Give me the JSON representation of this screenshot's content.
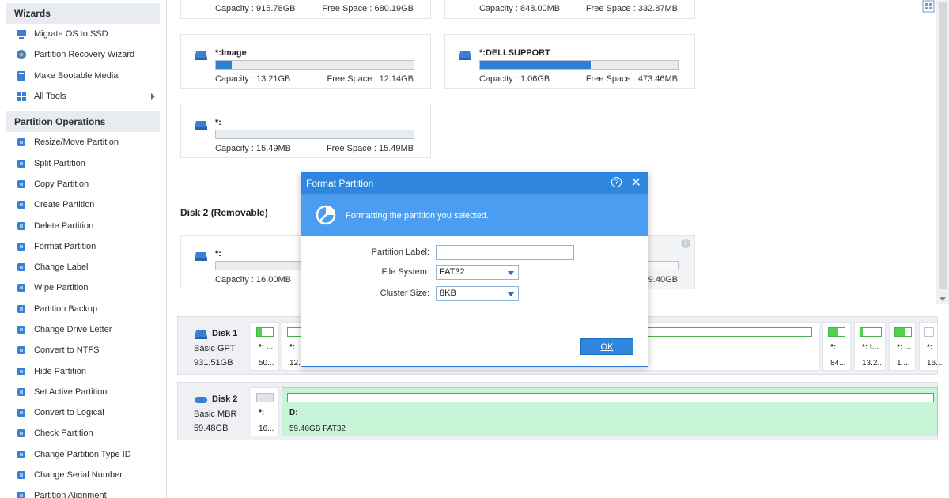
{
  "sidebar": {
    "wizards": {
      "title": "Wizards",
      "items": [
        {
          "label": "Migrate OS to SSD",
          "icon": "migrate-os-icon"
        },
        {
          "label": "Partition Recovery Wizard",
          "icon": "partition-recovery-icon"
        },
        {
          "label": "Make Bootable Media",
          "icon": "bootable-media-icon"
        },
        {
          "label": "All Tools",
          "icon": "all-tools-icon"
        }
      ]
    },
    "operations": {
      "title": "Partition Operations",
      "items": [
        {
          "label": "Resize/Move Partition",
          "icon": "resize-icon"
        },
        {
          "label": "Split Partition",
          "icon": "split-icon"
        },
        {
          "label": "Copy Partition",
          "icon": "copy-icon"
        },
        {
          "label": "Create Partition",
          "icon": "create-icon"
        },
        {
          "label": "Delete Partition",
          "icon": "delete-icon"
        },
        {
          "label": "Format Partition",
          "icon": "format-icon"
        },
        {
          "label": "Change Label",
          "icon": "label-icon"
        },
        {
          "label": "Wipe Partition",
          "icon": "wipe-icon"
        },
        {
          "label": "Partition Backup",
          "icon": "backup-icon"
        },
        {
          "label": "Change Drive Letter",
          "icon": "drive-letter-icon"
        },
        {
          "label": "Convert to NTFS",
          "icon": "convert-ntfs-icon"
        },
        {
          "label": "Hide Partition",
          "icon": "hide-icon"
        },
        {
          "label": "Set Active Partition",
          "icon": "set-active-icon"
        },
        {
          "label": "Convert to Logical",
          "icon": "convert-logical-icon"
        },
        {
          "label": "Check Partition",
          "icon": "check-icon"
        },
        {
          "label": "Change Partition Type ID",
          "icon": "type-id-icon"
        },
        {
          "label": "Change Serial Number",
          "icon": "serial-icon"
        },
        {
          "label": "Partition Alignment",
          "icon": "alignment-icon"
        }
      ]
    }
  },
  "partitions": {
    "top_left": {
      "capacity": "Capacity : 915.78GB",
      "free": "Free Space : 680.19GB"
    },
    "top_right": {
      "capacity": "Capacity : 848.00MB",
      "free": "Free Space : 332.87MB"
    },
    "image": {
      "name": "*:Image",
      "capacity": "Capacity : 13.21GB",
      "free": "Free Space : 12.14GB",
      "used_fraction": 0.08
    },
    "dellsupport": {
      "name": "*:DELLSUPPORT",
      "capacity": "Capacity : 1.06GB",
      "free": "Free Space : 473.46MB",
      "used_fraction": 0.56
    },
    "star": {
      "name": "*:",
      "capacity": "Capacity : 15.49MB",
      "free": "Free Space : 15.49MB",
      "used_fraction": 0
    },
    "disk2_title": "Disk 2 (Removable)",
    "removable": {
      "name": "*:",
      "capacity": "Capacity : 16.00MB",
      "free_partial": "59.40GB"
    }
  },
  "dialog": {
    "title": "Format Partition",
    "help": "?",
    "close": "✕",
    "banner": "Formatting the partition you selected.",
    "label_field": {
      "label": "Partition Label:",
      "value": ""
    },
    "filesystem": {
      "label": "File System:",
      "value": "FAT32"
    },
    "cluster": {
      "label": "Cluster Size:",
      "value": "8KB"
    },
    "ok": "OK"
  },
  "diskmap": {
    "disk1": {
      "name": "Disk 1",
      "type": "Basic GPT",
      "size": "931.51GB",
      "segments": [
        {
          "name": "*: ...",
          "size": "50...",
          "used_fraction": 0.3
        },
        {
          "name": "*:",
          "size": "12..."
        },
        {
          "name": "*:",
          "size": "84...",
          "used_fraction": 0.6
        },
        {
          "name": "*: I...",
          "size": "13.2...",
          "used_fraction": 0.1
        },
        {
          "name": "*: ...",
          "size": "1....",
          "used_fraction": 0.6
        },
        {
          "name": "*:",
          "size": "16..."
        }
      ]
    },
    "disk2": {
      "name": "Disk 2",
      "type": "Basic MBR",
      "size": "59.48GB",
      "segments": [
        {
          "name": "*:",
          "size": "16..."
        },
        {
          "name": "D:",
          "size": "59.46GB FAT32"
        }
      ]
    }
  },
  "colors": {
    "accent": "#2e86de",
    "banner": "#4a9df0",
    "selected_partition": "#c8f5d8",
    "used_bar": "#2f7fd9"
  }
}
